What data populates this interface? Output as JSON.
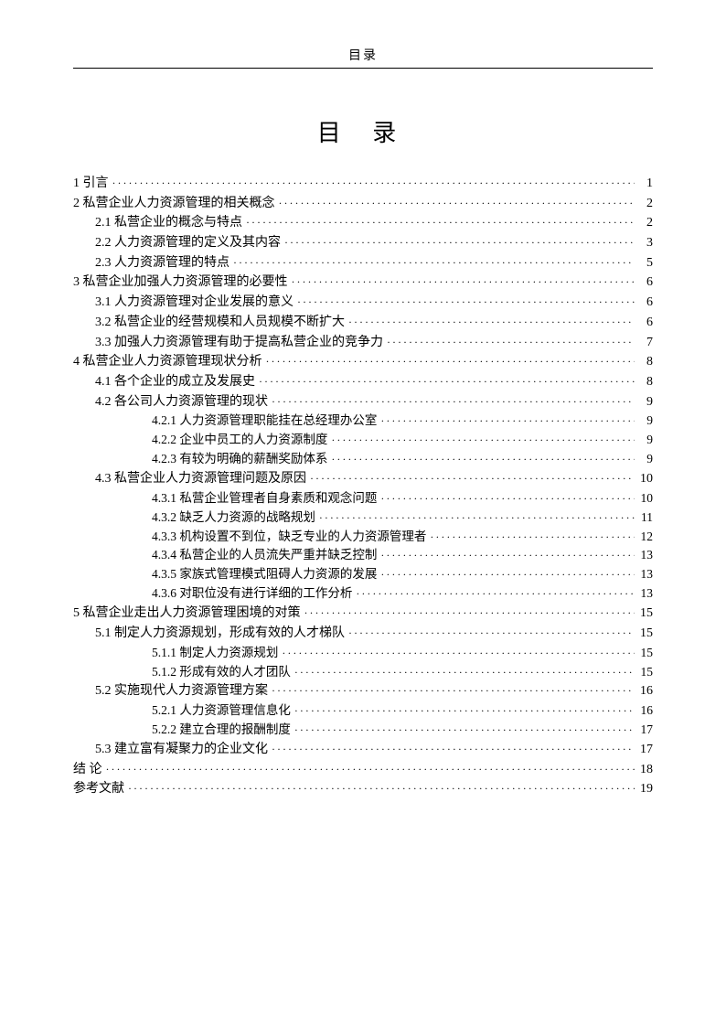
{
  "header": "目录",
  "title": "目  录",
  "entries": [
    {
      "level": 0,
      "label": "1 引言",
      "page": "1"
    },
    {
      "level": 0,
      "label": "2 私营企业人力资源管理的相关概念",
      "page": "2"
    },
    {
      "level": 1,
      "label": "2.1 私营企业的概念与特点",
      "page": "2"
    },
    {
      "level": 1,
      "label": "2.2 人力资源管理的定义及其内容",
      "page": "3"
    },
    {
      "level": 1,
      "label": "2.3 人力资源管理的特点",
      "page": "5"
    },
    {
      "level": 0,
      "label": "3 私营企业加强人力资源管理的必要性",
      "page": "6"
    },
    {
      "level": 1,
      "label": "3.1 人力资源管理对企业发展的意义",
      "page": "6"
    },
    {
      "level": 1,
      "label": "3.2 私营企业的经营规模和人员规模不断扩大",
      "page": "6"
    },
    {
      "level": 1,
      "label": "3.3 加强人力资源管理有助于提高私营企业的竞争力",
      "page": "7"
    },
    {
      "level": 0,
      "label": "4 私营企业人力资源管理现状分析",
      "page": "8"
    },
    {
      "level": 1,
      "label": "4.1 各个企业的成立及发展史",
      "page": "8"
    },
    {
      "level": 1,
      "label": "4.2 各公司人力资源管理的现状",
      "page": "9"
    },
    {
      "level": 2,
      "label": "4.2.1 人力资源管理职能挂在总经理办公室",
      "page": "9"
    },
    {
      "level": 2,
      "label": "4.2.2 企业中员工的人力资源制度",
      "page": "9"
    },
    {
      "level": 2,
      "label": "4.2.3 有较为明确的薪酬奖励体系",
      "page": "9"
    },
    {
      "level": 1,
      "label": "4.3 私营企业人力资源管理问题及原因",
      "page": "10"
    },
    {
      "level": 2,
      "label": "4.3.1 私营企业管理者自身素质和观念问题",
      "page": "10"
    },
    {
      "level": 2,
      "label": "4.3.2 缺乏人力资源的战略规划",
      "page": "11"
    },
    {
      "level": 2,
      "label": "4.3.3 机构设置不到位，缺乏专业的人力资源管理者",
      "page": "12"
    },
    {
      "level": 2,
      "label": "4.3.4 私营企业的人员流失严重并缺乏控制",
      "page": "13"
    },
    {
      "level": 2,
      "label": "4.3.5 家族式管理模式阻碍人力资源的发展",
      "page": "13"
    },
    {
      "level": 2,
      "label": "4.3.6 对职位没有进行详细的工作分析",
      "page": "13"
    },
    {
      "level": 0,
      "label": "5 私营企业走出人力资源管理困境的对策",
      "page": "15"
    },
    {
      "level": 1,
      "label": "5.1 制定人力资源规划，形成有效的人才梯队",
      "page": "15"
    },
    {
      "level": 2,
      "label": "5.1.1 制定人力资源规划",
      "page": "15"
    },
    {
      "level": 2,
      "label": "5.1.2 形成有效的人才团队",
      "page": "15"
    },
    {
      "level": 1,
      "label": "5.2 实施现代人力资源管理方案",
      "page": "16"
    },
    {
      "level": 2,
      "label": "5.2.1 人力资源管理信息化",
      "page": "16"
    },
    {
      "level": 2,
      "label": "5.2.2 建立合理的报酬制度",
      "page": "17"
    },
    {
      "level": 1,
      "label": "5.3 建立富有凝聚力的企业文化",
      "page": "17"
    },
    {
      "level": 0,
      "label": "结  论",
      "page": "18"
    },
    {
      "level": 0,
      "label": "参考文献",
      "page": "19"
    }
  ]
}
